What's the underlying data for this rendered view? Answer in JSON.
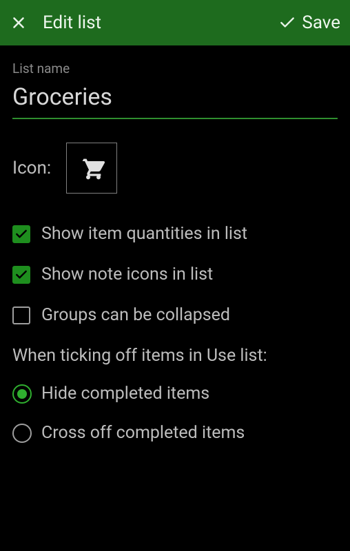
{
  "header": {
    "title": "Edit list",
    "save_label": "Save"
  },
  "list_name": {
    "label": "List name",
    "value": "Groceries"
  },
  "icon": {
    "label": "Icon:",
    "selected": "cart-icon"
  },
  "options": {
    "show_quantities": {
      "label": "Show item quantities in list",
      "checked": true
    },
    "show_note_icons": {
      "label": "Show note icons in list",
      "checked": true
    },
    "collapsible_groups": {
      "label": "Groups can be collapsed",
      "checked": false
    }
  },
  "tick_section": {
    "heading": "When ticking off items in Use list:",
    "choices": {
      "hide": {
        "label": "Hide completed items"
      },
      "cross": {
        "label": "Cross off completed items"
      }
    },
    "selected": "hide"
  }
}
